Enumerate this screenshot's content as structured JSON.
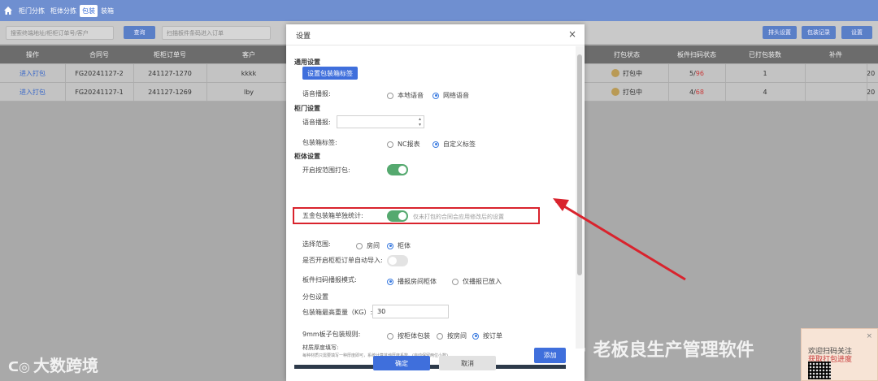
{
  "topnav": {
    "tabs": [
      "柜门分拣",
      "柜体分拣",
      "包装",
      "装箱"
    ],
    "active_index": 2
  },
  "toolbar": {
    "search_placeholder": "搜索终端地址/柜柜订单号/客户",
    "query_label": "查询",
    "scan_placeholder": "扫描板件条码进入订单",
    "buttons": [
      "排头设置",
      "包装记录",
      "设置"
    ]
  },
  "table": {
    "headers": [
      "操作",
      "合同号",
      "柜柜订单号",
      "客户",
      "打包状态",
      "板件扫码状态",
      "已打包装数",
      "补件"
    ],
    "rows": [
      {
        "action": "进入打包",
        "contract": "FG20241127-2",
        "order": "241127-1270",
        "customer": "kkkk",
        "status": "打包中",
        "scan_done": "5",
        "scan_total": "96",
        "packed": "1",
        "extra": "20"
      },
      {
        "action": "进入打包",
        "contract": "FG20241127-1",
        "order": "241127-1269",
        "customer": "lby",
        "status": "打包中",
        "scan_done": "4",
        "scan_total": "68",
        "packed": "4",
        "extra": "20"
      }
    ]
  },
  "modal": {
    "title": "设置",
    "close": "×",
    "general_section": "通用设置",
    "set_label_button": "设置包装箱标签",
    "voice_label": "语音播报:",
    "voice_opt_local": "本地语音",
    "voice_opt_net": "网络语音",
    "door_section": "柜门设置",
    "door_voice_label": "语音播报:",
    "box_label_label": "包装箱标签:",
    "box_opt_nc": "NC报表",
    "box_opt_custom": "自定义标签",
    "body_section": "柜体设置",
    "range_pack_label": "开启按范围打包:",
    "hardware_label": "五金包装箱单独统计:",
    "hardware_hint": "仅未打包的合同会应用修改后的设置",
    "select_range_label": "选择范围:",
    "range_opt_room": "房间",
    "range_opt_body": "柜体",
    "auto_import_label": "是否开启柜柜订单自动导入:",
    "scan_mode_label": "板件扫码播报模式:",
    "scan_opt_room": "播报房间柜体",
    "scan_opt_only": "仅播报已放入",
    "split_label": "分包设置",
    "max_weight_label": "包装箱最高重量（KG）:",
    "max_weight_value": "30",
    "rule_label": "9mm板子包装规则:",
    "rule_opt_body": "按柜体包装",
    "rule_opt_room": "按房间",
    "rule_opt_order": "按订单",
    "thickness_label": "材质厚度填写:",
    "thickness_hint": "每种材质只需要填写一种厚度即可，系统计算其他厚度系数。(自动保留两位小数)",
    "add_button": "添加",
    "ok_button": "确定",
    "cancel_button": "取消"
  },
  "watermarks": {
    "left": "大数跨境",
    "right": "公众号 · 老板良生产管理软件"
  },
  "corner_ad": {
    "line1": "欢迎扫码关注",
    "line2": "获取打包进度"
  },
  "colors": {
    "accent": "#3f6fdc",
    "toggle_on": "#55a96f",
    "highlight": "#d9232d"
  }
}
